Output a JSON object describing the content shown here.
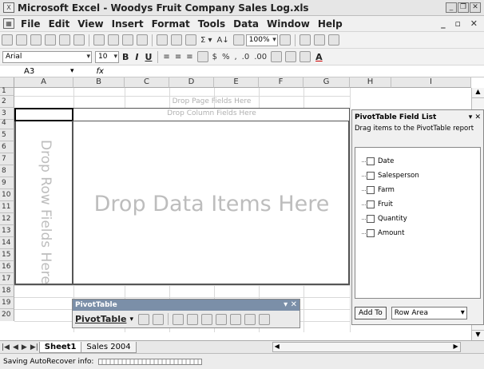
{
  "window": {
    "title": "Microsoft Excel - Woodys Fruit Company Sales Log.xls"
  },
  "menu": [
    "File",
    "Edit",
    "View",
    "Insert",
    "Format",
    "Tools",
    "Data",
    "Window",
    "Help"
  ],
  "toolbar": {
    "zoom": "100%",
    "font_name": "Arial",
    "font_size": "10"
  },
  "formula": {
    "name_box": "A3",
    "fx": "fx"
  },
  "columns": [
    "A",
    "B",
    "C",
    "D",
    "E",
    "F",
    "G",
    "H",
    "I"
  ],
  "rows": [
    "1",
    "2",
    "3",
    "4",
    "5",
    "6",
    "7",
    "8",
    "9",
    "10",
    "11",
    "12",
    "13",
    "14",
    "15",
    "16",
    "17",
    "18",
    "19",
    "20"
  ],
  "pivot": {
    "page_fields": "Drop Page Fields Here",
    "column_fields": "Drop Column Fields Here",
    "row_fields": "Drop Row Fields Here",
    "data_items": "Drop Data Items Here"
  },
  "field_list": {
    "title": "PivotTable Field List",
    "description": "Drag items to the PivotTable report",
    "fields": [
      "Date",
      "Salesperson",
      "Farm",
      "Fruit",
      "Quantity",
      "Amount"
    ],
    "add_button": "Add To",
    "area_select": "Row Area"
  },
  "pivot_toolbar": {
    "title": "PivotTable",
    "menu": "PivotTable"
  },
  "sheets": {
    "tabs": [
      "Sheet1",
      "Sales 2004"
    ],
    "active": "Sheet1"
  },
  "status": {
    "text": "Saving AutoRecover info:",
    "progress": 0.0
  }
}
